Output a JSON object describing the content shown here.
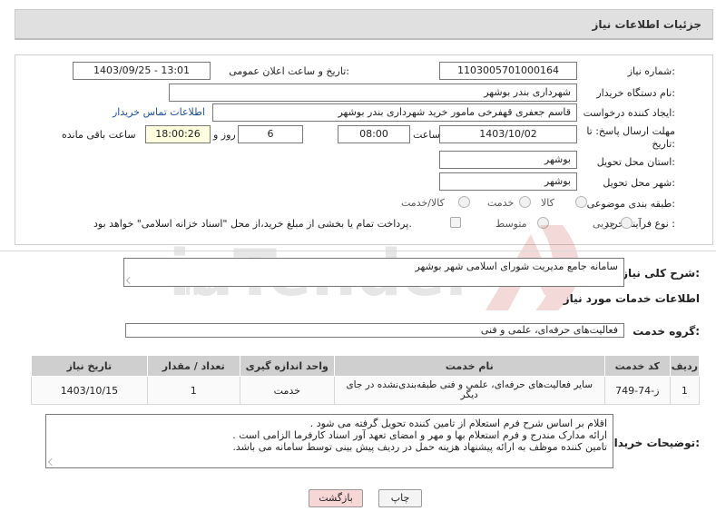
{
  "header": {
    "title": "جزئیات اطلاعات نیاز"
  },
  "form": {
    "need_number_label": "شماره نیاز:",
    "need_number": "1103005701000164",
    "announce_label": "تاریخ و ساعت اعلان عمومی:",
    "announce_value": "1403/09/25 - 13:01",
    "buyer_label": "نام دستگاه خریدار:",
    "buyer_value": "شهرداری بندر بوشهر",
    "creator_label": "ایجاد کننده درخواست:",
    "creator_value": "قاسم جعفری قهفرخی مامور خرید  شهرداری بندر بوشهر",
    "contact_link": "اطلاعات تماس خریدار",
    "deadline_label": "مهلت ارسال پاسخ: تا تاریخ:",
    "deadline_date": "1403/10/02",
    "time_label": "ساعت",
    "deadline_time": "08:00",
    "days_value": "6",
    "days_label": "روز و",
    "remaining_time": "18:00:26",
    "remaining_label": "ساعت باقی مانده",
    "province_label": "استان محل تحویل:",
    "province_value": "بوشهر",
    "city_label": "شهر محل تحویل:",
    "city_value": "بوشهر",
    "category_label": "طبقه بندی موضوعی:",
    "category_options": [
      "کالا",
      "خدمت",
      "کالا/خدمت"
    ],
    "process_label": "نوع فرآیند خرید :",
    "process_options": [
      "جزیی",
      "متوسط"
    ],
    "payment_note": "پرداخت تمام یا بخشی از مبلغ خرید،از محل \"اسناد خزانه اسلامی\" خواهد بود."
  },
  "summary": {
    "label": "شرح کلی نیاز:",
    "value": "سامانه جامع مدیریت شورای اسلامی شهر بوشهر"
  },
  "services": {
    "section_title": "اطلاعات خدمات مورد نیاز",
    "group_label": "گروه خدمت:",
    "group_value": "فعالیت‌های حرفه‌ای، علمی و فنی",
    "columns": [
      "ردیف",
      "کد خدمت",
      "نام خدمت",
      "واحد اندازه گیری",
      "تعداد / مقدار",
      "تاریخ نیاز"
    ],
    "rows": [
      {
        "row": "1",
        "code": "ز-74-749",
        "name": "سایر فعالیت‌های حرفه‌ای، علمی و فنی طبقه‌بندی‌نشده در جای دیگر",
        "unit": "خدمت",
        "qty": "1",
        "date": "1403/10/15"
      }
    ]
  },
  "notes": {
    "label": "توضیحات خریدار:",
    "line1": "اقلام بر اساس شرح فرم استعلام از تامین کننده تحویل گرفته می شود .",
    "line2": "ارائه مدارک مندرج و فرم استعلام بها و مهر و امضای تعهد آور اسناد کارفرما الزامی است .",
    "line3": "تامین  کننده موظف به ارائه پیشنهاد هزینه حمل در ردیف پیش بینی توسط سامانه می باشد."
  },
  "buttons": {
    "print": "چاپ",
    "back": "بازگشت"
  },
  "colors": {
    "header_bg": "#e0e0e0",
    "link": "#1a4fa0",
    "back_button": "#f7d6d6"
  }
}
